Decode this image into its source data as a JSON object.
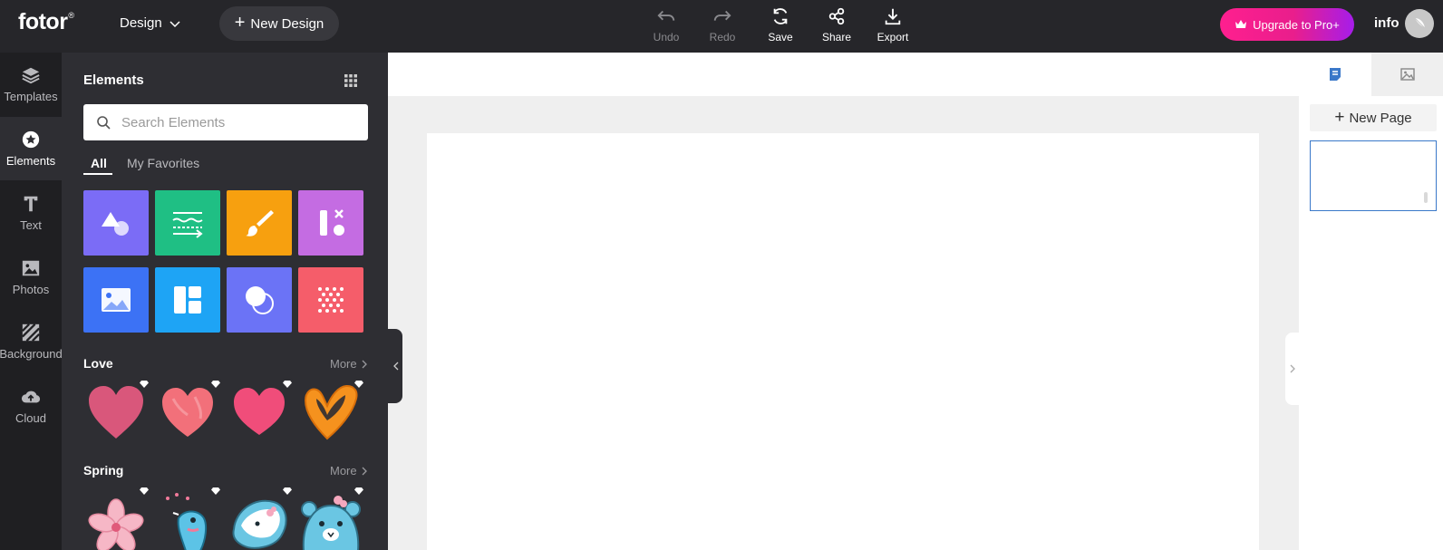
{
  "app": {
    "logo": "fotor",
    "logo_mark": "®",
    "design_menu": "Design",
    "new_design": "New Design"
  },
  "toolbar": {
    "undo": "Undo",
    "redo": "Redo",
    "save": "Save",
    "share": "Share",
    "export": "Export"
  },
  "account": {
    "upgrade": "Upgrade to Pro+",
    "user": "info"
  },
  "leftnav": {
    "items": [
      {
        "label": "Templates",
        "icon": "layers-icon"
      },
      {
        "label": "Elements",
        "icon": "star-icon"
      },
      {
        "label": "Text",
        "icon": "text-icon"
      },
      {
        "label": "Photos",
        "icon": "photo-icon"
      },
      {
        "label": "Background",
        "icon": "background-icon"
      },
      {
        "label": "Cloud",
        "icon": "cloud-upload-icon"
      }
    ],
    "active": "Elements"
  },
  "panel": {
    "title": "Elements",
    "search_placeholder": "Search Elements",
    "tabs": [
      "All",
      "My Favorites"
    ],
    "active_tab": "All",
    "categories": [
      {
        "icon": "shapes-icon",
        "color": "#7b6cf6"
      },
      {
        "icon": "lines-icon",
        "color": "#1fbf84"
      },
      {
        "icon": "brush-icon",
        "color": "#f7a00f"
      },
      {
        "icon": "shape-crossed-icon",
        "color": "#c46ce2"
      },
      {
        "icon": "image-icon",
        "color": "#3c72f5"
      },
      {
        "icon": "grid-layout-icon",
        "color": "#1ea4f5"
      },
      {
        "icon": "circles-icon",
        "color": "#6b73f6"
      },
      {
        "icon": "dots-pattern-icon",
        "color": "#f55d6a"
      }
    ],
    "sections": [
      {
        "title": "Love",
        "more": "More",
        "stickers": [
          "heart-pink-icon",
          "heart-watercolor-icon",
          "heart-bright-icon",
          "heart-orange-icon"
        ]
      },
      {
        "title": "Spring",
        "more": "More",
        "stickers": [
          "sakura-flower-icon",
          "bird-icon",
          "cow-icon",
          "bear-icon"
        ]
      }
    ]
  },
  "pages": {
    "new_page": "New Page"
  },
  "colors": {
    "topbar": "#26262a",
    "panel": "#2e2e33",
    "upgrade_gradient": [
      "#ff1f8f",
      "#a61dea"
    ],
    "page_border": "#3a78c9"
  }
}
